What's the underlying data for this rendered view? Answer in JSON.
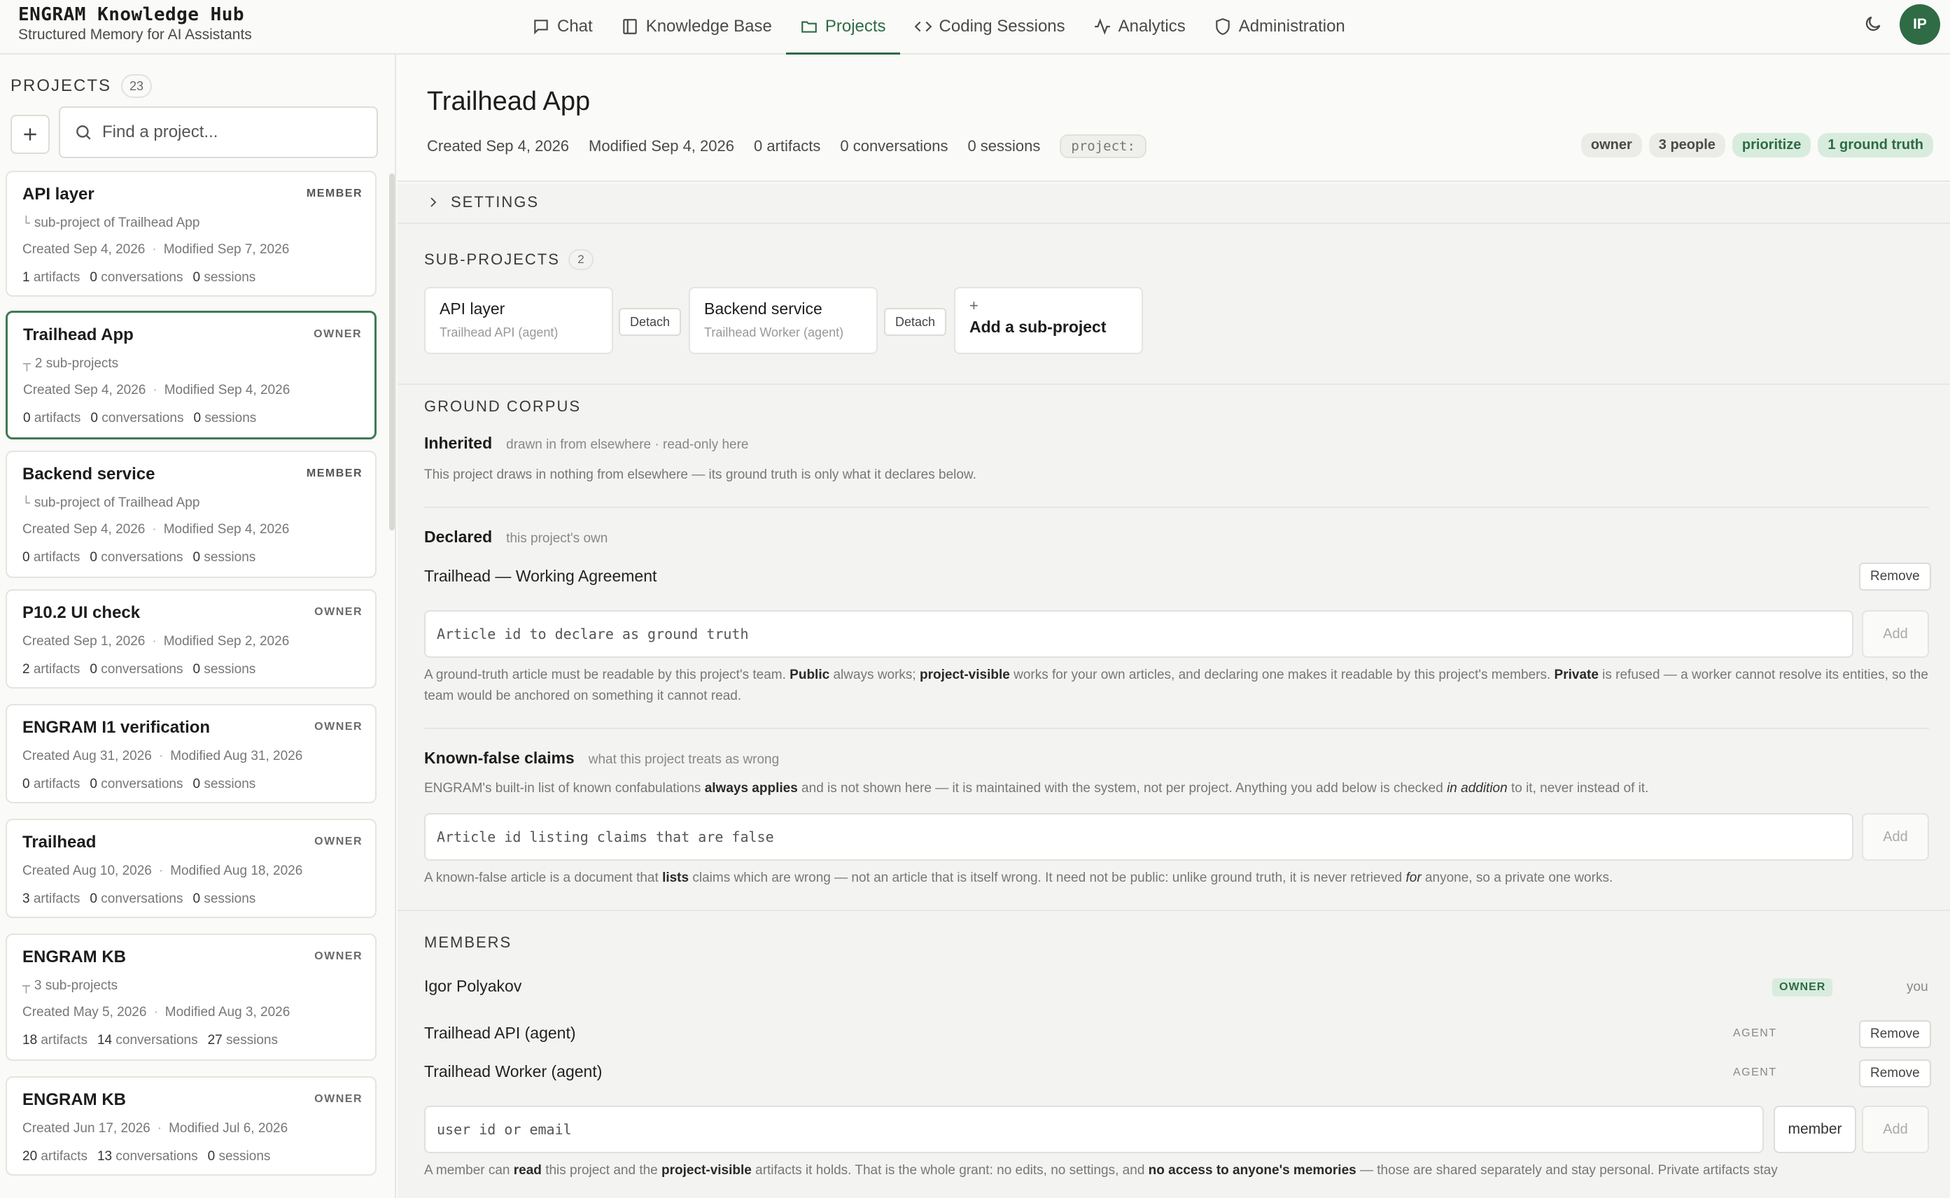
{
  "app": {
    "title": "ENGRAM Knowledge Hub",
    "subtitle": "Structured Memory for AI Assistants",
    "avatar_initials": "IP"
  },
  "nav": [
    {
      "label": "Chat",
      "icon": "chat-icon"
    },
    {
      "label": "Knowledge Base",
      "icon": "book-icon"
    },
    {
      "label": "Projects",
      "icon": "folder-icon",
      "active": true
    },
    {
      "label": "Coding Sessions",
      "icon": "code-icon"
    },
    {
      "label": "Analytics",
      "icon": "pulse-icon"
    },
    {
      "label": "Administration",
      "icon": "shield-icon"
    }
  ],
  "sidebar": {
    "title": "PROJECTS",
    "count": "23",
    "search_placeholder": "Find a project...",
    "projects": [
      {
        "name": "API layer",
        "role": "MEMBER",
        "sub": "sub-project of Trailhead App",
        "sub_glyph": "└",
        "created": "Created Sep 4, 2026",
        "modified": "Modified Sep 7, 2026",
        "artifacts": "1",
        "conversations": "0",
        "sessions": "0"
      },
      {
        "name": "Trailhead App",
        "role": "OWNER",
        "sub": "2 sub-projects",
        "sub_glyph": "┬",
        "created": "Created Sep 4, 2026",
        "modified": "Modified Sep 4, 2026",
        "artifacts": "0",
        "conversations": "0",
        "sessions": "0"
      },
      {
        "name": "Backend service",
        "role": "MEMBER",
        "sub": "sub-project of Trailhead App",
        "sub_glyph": "└",
        "created": "Created Sep 4, 2026",
        "modified": "Modified Sep 4, 2026",
        "artifacts": "0",
        "conversations": "0",
        "sessions": "0"
      },
      {
        "name": "P10.2 UI check",
        "role": "OWNER",
        "sub": "",
        "sub_glyph": "",
        "created": "Created Sep 1, 2026",
        "modified": "Modified Sep 2, 2026",
        "artifacts": "2",
        "conversations": "0",
        "sessions": "0"
      },
      {
        "name": "ENGRAM I1 verification",
        "role": "OWNER",
        "sub": "",
        "sub_glyph": "",
        "created": "Created Aug 31, 2026",
        "modified": "Modified Aug 31, 2026",
        "artifacts": "0",
        "conversations": "0",
        "sessions": "0"
      },
      {
        "name": "Trailhead",
        "role": "OWNER",
        "sub": "",
        "sub_glyph": "",
        "created": "Created Aug 10, 2026",
        "modified": "Modified Aug 18, 2026",
        "artifacts": "3",
        "conversations": "0",
        "sessions": "0"
      },
      {
        "name": "ENGRAM KB",
        "role": "OWNER",
        "sub": "3 sub-projects",
        "sub_glyph": "┬",
        "created": "Created May 5, 2026",
        "modified": "Modified Aug 3, 2026",
        "artifacts": "18",
        "conversations": "14",
        "sessions": "27"
      },
      {
        "name": "ENGRAM KB",
        "role": "OWNER",
        "sub": "",
        "sub_glyph": "",
        "created": "Created Jun 17, 2026",
        "modified": "Modified Jul 6, 2026",
        "artifacts": "20",
        "conversations": "13",
        "sessions": "0"
      }
    ],
    "labels": {
      "artifacts": "artifacts",
      "conversations": "conversations",
      "sessions": "sessions"
    }
  },
  "detail": {
    "title": "Trailhead App",
    "meta": {
      "created": "Created Sep 4, 2026",
      "modified": "Modified Sep 4, 2026",
      "artifacts": "0 artifacts",
      "conversations": "0 conversations",
      "sessions": "0 sessions",
      "tag": "project:"
    },
    "chips": [
      {
        "label": "owner",
        "style": "gray"
      },
      {
        "label": "3 people",
        "style": "gray"
      },
      {
        "label": "prioritize",
        "style": "green"
      },
      {
        "label": "1 ground truth",
        "style": "green"
      }
    ],
    "settings_label": "SETTINGS",
    "subprojects": {
      "title": "SUB-PROJECTS",
      "count": "2",
      "items": [
        {
          "name": "API layer",
          "agent": "Trailhead API (agent)",
          "detach": "Detach"
        },
        {
          "name": "Backend service",
          "agent": "Trailhead Worker (agent)",
          "detach": "Detach"
        }
      ],
      "add_plus": "+",
      "add_label": "Add a sub-project"
    },
    "ground_corpus": {
      "title": "GROUND CORPUS",
      "inherited_label": "Inherited",
      "inherited_hint": "drawn in from elsewhere · read-only here",
      "inherited_text": "This project draws in nothing from elsewhere — its ground truth is only what it declares below.",
      "declared_label": "Declared",
      "declared_hint": "this project's own",
      "declared_item": "Trailhead — Working Agreement",
      "remove": "Remove",
      "article_placeholder": "Article id to declare as ground truth",
      "add": "Add",
      "gt_help": {
        "p1": "A ground-truth article must be readable by this project's team. ",
        "b1": "Public",
        "p2": " always works; ",
        "b2": "project-visible",
        "p3": " works for your own articles, and declaring one makes it readable by this project's members. ",
        "b3": "Private",
        "p4": " is refused — a worker cannot resolve its entities, so the team would be anchored on something it cannot read."
      },
      "kf_label": "Known-false claims",
      "kf_hint": "what this project treats as wrong",
      "kf_text": {
        "p1": "ENGRAM's built-in list of known confabulations ",
        "b1": "always applies",
        "p2": " and is not shown here — it is maintained with the system, not per project. Anything you add below is checked ",
        "i1": "in addition",
        "p3": " to it, never instead of it."
      },
      "kf_placeholder": "Article id listing claims that are false",
      "kf_help": {
        "p1": "A known-false article is a document that ",
        "b1": "lists",
        "p2": " claims which are wrong — not an article that is itself wrong. It need not be public: unlike ground truth, it is never retrieved ",
        "i1": "for",
        "p3": " anyone, so a private one works."
      }
    },
    "members": {
      "title": "MEMBERS",
      "list": [
        {
          "name": "Igor Polyakov",
          "badge": "OWNER",
          "suffix": "you"
        },
        {
          "name": "Trailhead API (agent)",
          "role": "AGENT",
          "action": "Remove"
        },
        {
          "name": "Trailhead Worker (agent)",
          "role": "AGENT",
          "action": "Remove"
        }
      ],
      "user_placeholder": "user id or email",
      "role_value": "member",
      "add": "Add",
      "help": {
        "p1": "A member can ",
        "b1": "read",
        "p2": " this project and the ",
        "b2": "project-visible",
        "p3": " artifacts it holds. That is the whole grant: no edits, no settings, and ",
        "b3": "no access to anyone's memories",
        "p4": " — those are shared separately and stay personal. Private artifacts stay"
      }
    }
  }
}
